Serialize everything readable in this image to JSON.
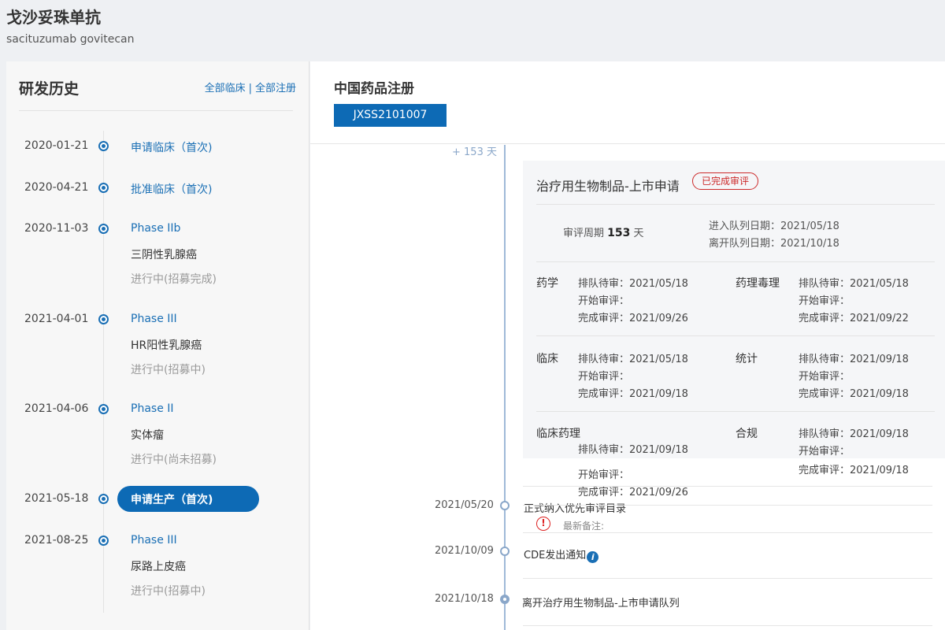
{
  "drug": {
    "name": "戈沙妥珠单抗",
    "english_name": "sacituzumab govitecan"
  },
  "history": {
    "title": "研发历史",
    "links": [
      "全部临床",
      "全部注册"
    ],
    "link_separator": "|",
    "items": [
      {
        "date": "2020-01-21",
        "phase": "申请临床（首次)",
        "indication": "",
        "status": ""
      },
      {
        "date": "2020-04-21",
        "phase": "批准临床（首次)",
        "indication": "",
        "status": ""
      },
      {
        "date": "2020-11-03",
        "phase": "Phase IIb",
        "indication": "三阴性乳腺癌",
        "status": "进行中(招募完成)"
      },
      {
        "date": "2021-04-01",
        "phase": "Phase III",
        "indication": "HR阳性乳腺癌",
        "status": "进行中(招募中)"
      },
      {
        "date": "2021-04-06",
        "phase": "Phase II",
        "indication": "实体瘤",
        "status": "进行中(尚未招募)"
      },
      {
        "date": "2021-05-18",
        "phase": "申请生产（首次)",
        "indication": "",
        "status": "",
        "selected": true
      },
      {
        "date": "2021-08-25",
        "phase": "Phase III",
        "indication": "尿路上皮癌",
        "status": "进行中(招募中)"
      }
    ]
  },
  "registration": {
    "title": "中国药品注册",
    "tab": "JXSS2101007",
    "interval": "+ 153 天",
    "card": {
      "title": "治疗用生物制品-上市申请",
      "badge": "已完成审评",
      "cycle_label": "审评周期",
      "cycle_days": "153",
      "cycle_unit": "天",
      "enter_queue": "进入队列日期：2021/05/18",
      "leave_queue": "离开队列日期：2021/10/18",
      "disciplines": [
        {
          "name": "药学",
          "queue": "排队待审：2021/05/18",
          "start": "开始审评：",
          "done": "完成审评：2021/09/26"
        },
        {
          "name": "药理毒理",
          "queue": "排队待审：2021/05/18",
          "start": "开始审评：",
          "done": "完成审评：2021/09/22"
        },
        {
          "name": "临床",
          "queue": "排队待审：2021/05/18",
          "start": "开始审评：",
          "done": "完成审评：2021/09/18"
        },
        {
          "name": "统计",
          "queue": "排队待审：2021/09/18",
          "start": "开始审评：",
          "done": "完成审评：2021/09/18"
        },
        {
          "name": "临床药理",
          "queue": "排队待审：2021/09/18",
          "start": "开始审评：",
          "done": "完成审评：2021/09/26"
        },
        {
          "name": "合规",
          "queue": "排队待审：2021/09/18",
          "start": "开始审评：",
          "done": "完成审评：2021/09/18"
        }
      ]
    },
    "events": [
      {
        "date": "2021/05/20",
        "text": "正式纳入优先审评目录",
        "note_label": "最新备注:"
      },
      {
        "date": "2021/10/09",
        "text": "CDE发出通知"
      },
      {
        "date": "2021/10/18",
        "text": "离开治疗用生物制品-上市申请队列"
      }
    ],
    "icons": {
      "warning": "warning-icon",
      "info": "info-icon"
    }
  }
}
